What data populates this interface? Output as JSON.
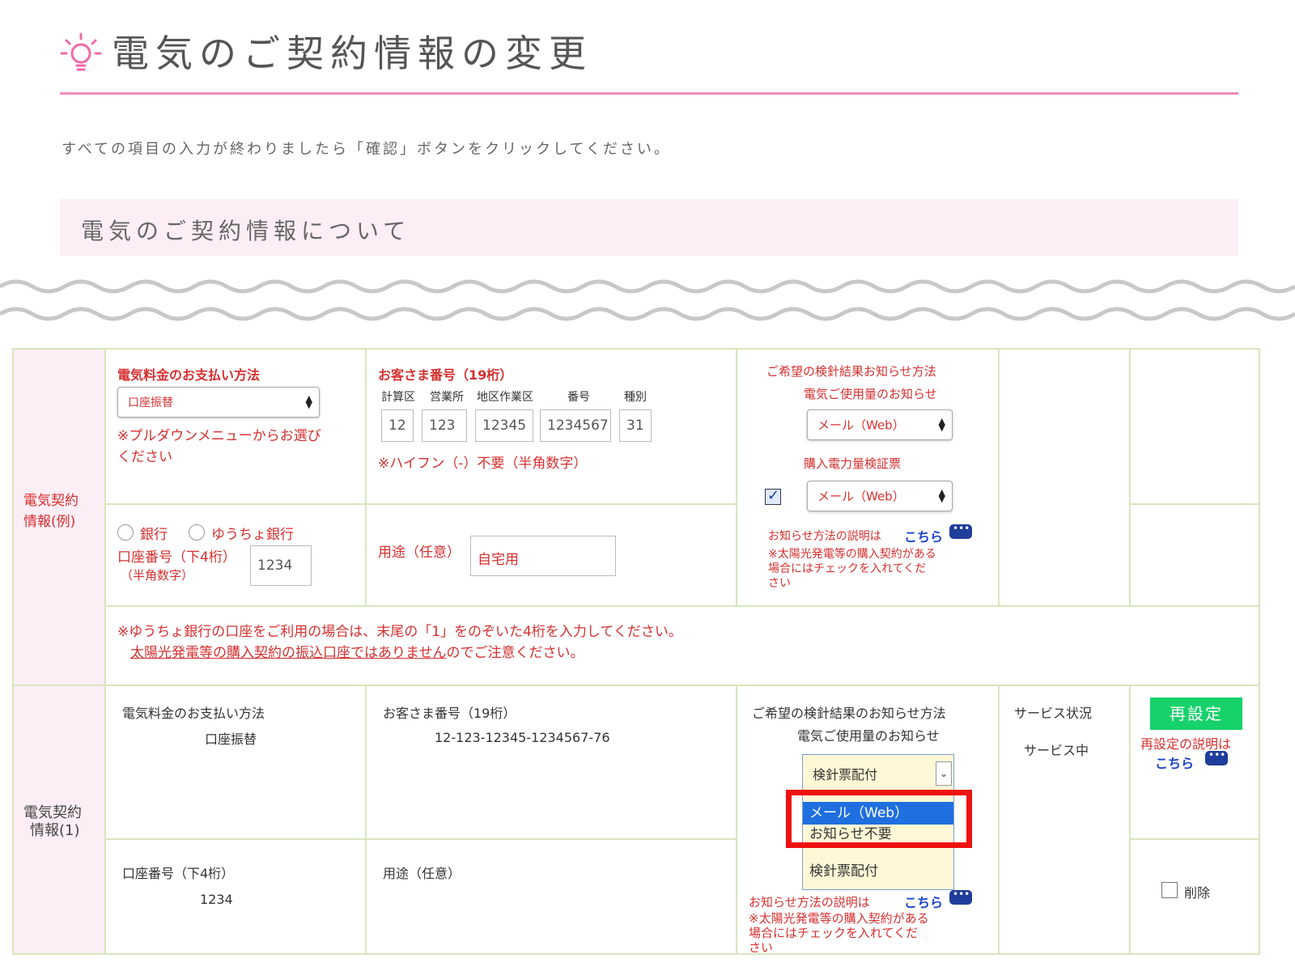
{
  "header": {
    "title": "電気のご契約情報の変更",
    "icon": "lightbulb-icon"
  },
  "instruction": "すべての項目の入力が終わりましたら「確認」ボタンをクリックしてください。",
  "section_title": "電気のご契約情報について",
  "example_row": {
    "label_line1": "電気契約",
    "label_line2": "情報(例)",
    "payment_label": "電気料金のお支払い方法",
    "payment_value": "口座振替",
    "payment_note_line1": "※プルダウンメニューからお選び",
    "payment_note_line2": "ください",
    "customer_label": "お客さま番号（19桁）",
    "sub_labels": [
      "計算区",
      "営業所",
      "地区作業区",
      "番号",
      "種別"
    ],
    "number_fields": [
      "12",
      "123",
      "12345",
      "1234567",
      "31"
    ],
    "hyphen_note": "※ハイフン（-）不要（半角数字）",
    "notice_title": "ご希望の検針結果お知らせ方法",
    "usage_notice_label": "電気ご使用量のお知らせ",
    "usage_notice_value": "メール（Web）",
    "purchase_label": "購入電力量検証票",
    "purchase_value": "メール（Web）",
    "explain_text": "お知らせ方法の説明は",
    "explain_link": "こちら",
    "solar_note_line1": "※太陽光発電等の購入契約がある",
    "solar_note_line2": "場合にはチェックを入れてくだ",
    "solar_note_line3": "さい",
    "bank_label": "銀行",
    "yucho_label": "ゆうちょ銀行",
    "account_label": "口座番号（下4桁）",
    "account_sub": "（半角数字）",
    "account_value": "1234",
    "usage_label": "用途（任意）",
    "usage_value": "自宅用",
    "yucho_note": "※ゆうちょ銀行の口座をご利用の場合は、末尾の「1」をのぞいた4桁を入力してください。",
    "solar_account_note_underlined": "太陽光発電等の購入契約の振込口座ではありません",
    "solar_account_note_rest": "のでご注意ください。"
  },
  "contract_row": {
    "label_line1": "電気契約",
    "label_line2": "情報(1)",
    "payment_label": "電気料金のお支払い方法",
    "payment_value": "口座振替",
    "customer_label": "お客さま番号（19桁）",
    "customer_value": "12-123-12345-1234567-76",
    "notice_title": "ご希望の検針結果のお知らせ方法",
    "usage_notice_label": "電気ご使用量のお知らせ",
    "select_current": "検針票配付",
    "dropdown_options": [
      "メール（Web）",
      "お知らせ不要",
      "検針票配付"
    ],
    "service_label": "サービス状況",
    "service_value": "サービス中",
    "reset_button": "再設定",
    "reset_explain_line1": "再設定の説明は",
    "reset_explain_link": "こちら",
    "account_label": "口座番号（下4桁）",
    "account_value": "1234",
    "usage_label": "用途（任意）",
    "explain_text": "お知らせ方法の説明は",
    "explain_link": "こちら",
    "solar_note_line1": "※太陽光発電等の購入契約がある",
    "solar_note_line2": "場合にはチェックを入れてくだ",
    "solar_note_line3": "さい",
    "delete_label": "削除"
  },
  "colors": {
    "accent_pink": "#f08cbf",
    "label_bg": "#fdeef5",
    "border_green": "#d7e6bd",
    "note_red": "#d63030",
    "link_blue": "#1b44c8",
    "reset_green": "#16d26a",
    "highlight_red": "#ee1111"
  }
}
